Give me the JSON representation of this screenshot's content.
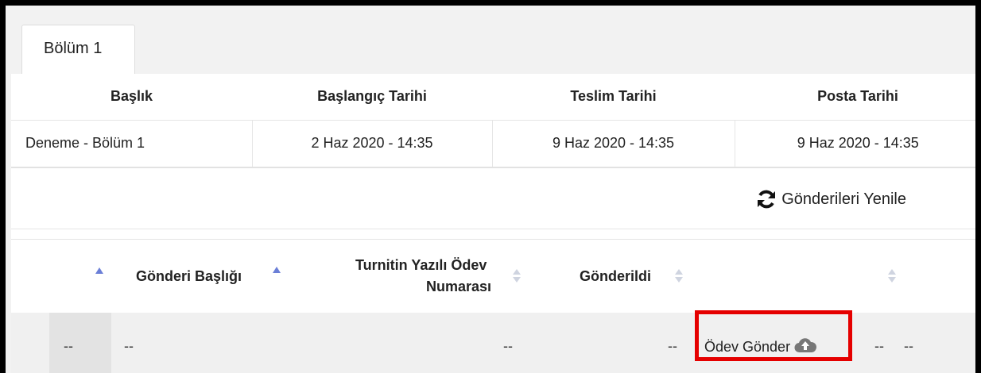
{
  "tab": {
    "label": "Bölüm 1"
  },
  "info_table": {
    "headers": [
      "Başlık",
      "Başlangıç Tarihi",
      "Teslim Tarihi",
      "Posta Tarihi"
    ],
    "row": [
      "Deneme - Bölüm 1",
      "2 Haz 2020 - 14:35",
      "9 Haz 2020 - 14:35",
      "9 Haz 2020 - 14:35"
    ]
  },
  "refresh": {
    "label": "Gönderileri Yenile",
    "icon": "refresh-icon"
  },
  "submissions": {
    "headers": {
      "title": "Gönderi Başlığı",
      "paper_id_line1": "Turnitin Yazılı Ödev",
      "paper_id_line2": "Numarası",
      "submitted": "Gönderildi"
    },
    "row": {
      "c0": "--",
      "title": "--",
      "paper_id": "--",
      "submitted": "--",
      "upload_label": "Ödev Gönder",
      "extra1": "--",
      "extra2": "--"
    }
  },
  "colors": {
    "highlight": "#e50000",
    "sort_active": "#6b7fd7"
  }
}
